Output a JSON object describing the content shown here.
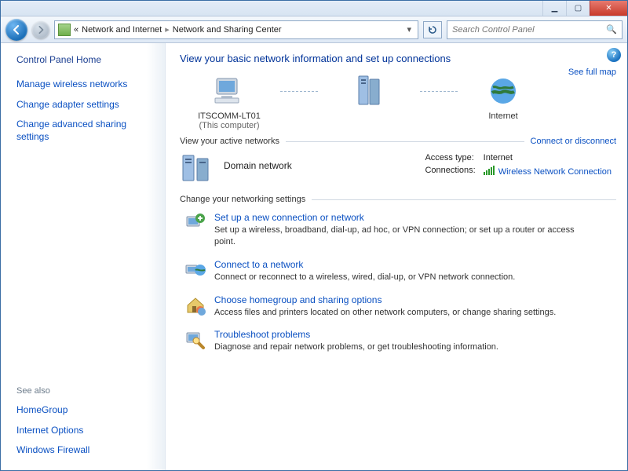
{
  "addressbar": {
    "crumb1": "Network and Internet",
    "crumb2": "Network and Sharing Center"
  },
  "search": {
    "placeholder": "Search Control Panel"
  },
  "sidebar": {
    "heading": "Control Panel Home",
    "links": {
      "wireless": "Manage wireless networks",
      "adapter": "Change adapter settings",
      "advanced": "Change advanced sharing settings"
    },
    "seealso_heading": "See also",
    "seealso": {
      "homegroup": "HomeGroup",
      "inetopt": "Internet Options",
      "firewall": "Windows Firewall"
    }
  },
  "main": {
    "title": "View your basic network information and set up connections",
    "full_map": "See full map",
    "computer_name": "ITSCOMM-LT01",
    "computer_sub": "(This computer)",
    "internet_label": "Internet",
    "active_header": "View your active networks",
    "connect_link": "Connect or disconnect",
    "network_name": "Domain network",
    "access_type_label": "Access type:",
    "access_type_value": "Internet",
    "connections_label": "Connections:",
    "connection_name": "Wireless Network Connection",
    "change_header": "Change your networking settings",
    "tasks": {
      "setup": {
        "title": "Set up a new connection or network",
        "desc": "Set up a wireless, broadband, dial-up, ad hoc, or VPN connection; or set up a router or access point."
      },
      "connect": {
        "title": "Connect to a network",
        "desc": "Connect or reconnect to a wireless, wired, dial-up, or VPN network connection."
      },
      "homegroup": {
        "title": "Choose homegroup and sharing options",
        "desc": "Access files and printers located on other network computers, or change sharing settings."
      },
      "troubleshoot": {
        "title": "Troubleshoot problems",
        "desc": "Diagnose and repair network problems, or get troubleshooting information."
      }
    }
  }
}
